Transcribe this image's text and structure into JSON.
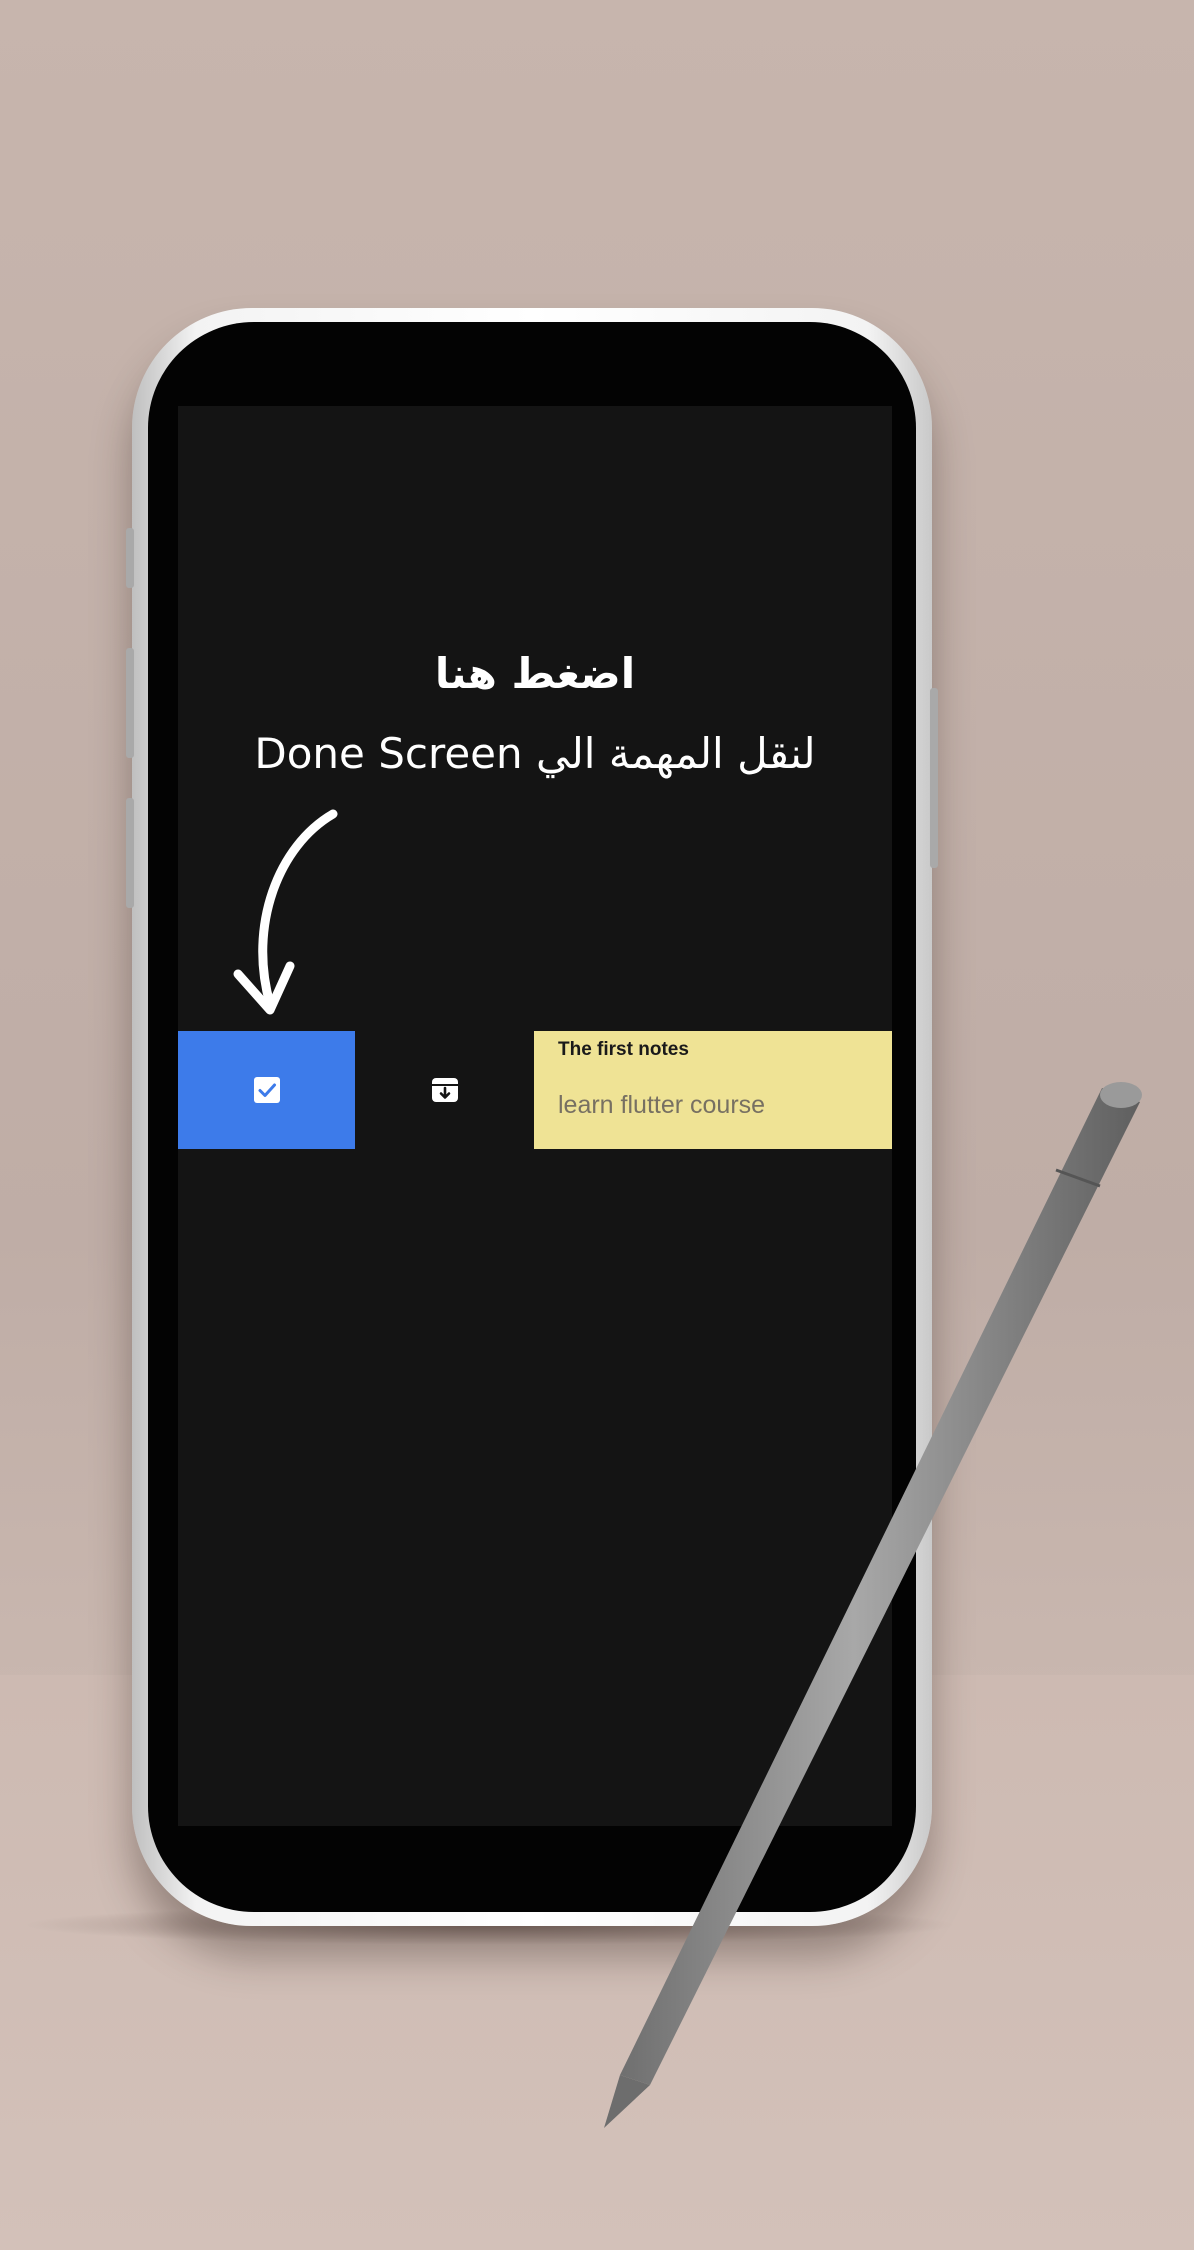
{
  "caption": {
    "line1": "اضغط هنا",
    "line2": "لنقل المهمة الي Done Screen"
  },
  "actions": {
    "done_icon": "check-box-icon",
    "done_color": "#3d7bea",
    "archive_icon": "archive-icon"
  },
  "note": {
    "title": "The first notes",
    "body": "learn flutter course",
    "color": "#efe395"
  },
  "icons": {
    "arrow": "curved-arrow-icon"
  }
}
